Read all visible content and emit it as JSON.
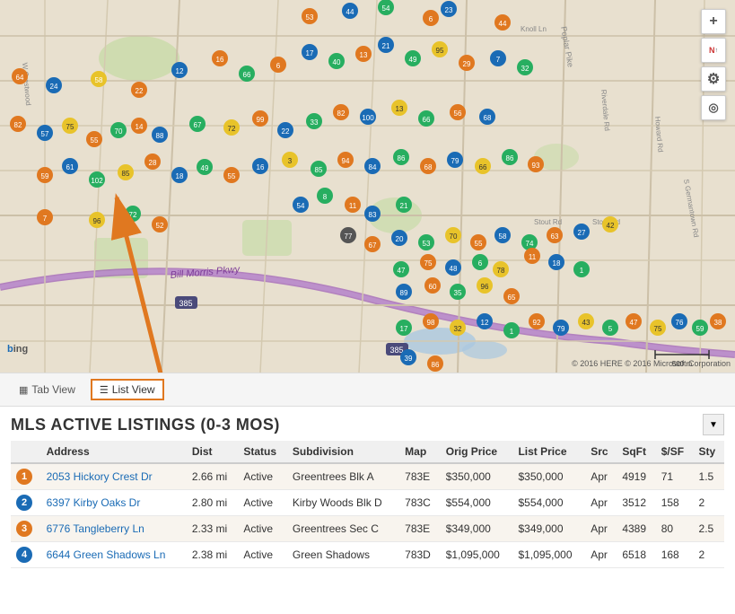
{
  "map": {
    "attribution": "© 2016 HERE  © 2016 Microsoft Corporation",
    "bing_label": "bing"
  },
  "view_toggle": {
    "tab_view_label": "Tab View",
    "list_view_label": "List View",
    "tab_icon": "▦",
    "list_icon": "☰"
  },
  "listings": {
    "title": "MLS ACTIVE LISTINGS (0-3 MOS)",
    "columns": [
      "Address",
      "Dist",
      "Status",
      "Subdivision",
      "Map",
      "Orig Price",
      "List Price",
      "Src",
      "SqFt",
      "$/SF",
      "Sty"
    ],
    "rows": [
      {
        "num": 1,
        "num_color": "#e07820",
        "address": "2053 Hickory Crest Dr",
        "dist": "2.66 mi",
        "status": "Active",
        "subdivision": "Greentrees Blk A",
        "map": "783E",
        "orig_price": "$350,000",
        "list_price": "$350,000",
        "src": "Apr",
        "sqft": "4919",
        "psf": "71",
        "sty": "1.5"
      },
      {
        "num": 2,
        "num_color": "#1a6bb5",
        "address": "6397 Kirby Oaks Dr",
        "dist": "2.80 mi",
        "status": "Active",
        "subdivision": "Kirby Woods Blk D",
        "map": "783C",
        "orig_price": "$554,000",
        "list_price": "$554,000",
        "src": "Apr",
        "sqft": "3512",
        "psf": "158",
        "sty": "2"
      },
      {
        "num": 3,
        "num_color": "#e07820",
        "address": "6776 Tangleberry Ln",
        "dist": "2.33 mi",
        "status": "Active",
        "subdivision": "Greentrees Sec C",
        "map": "783E",
        "orig_price": "$349,000",
        "list_price": "$349,000",
        "src": "Apr",
        "sqft": "4389",
        "psf": "80",
        "sty": "2.5"
      },
      {
        "num": 4,
        "num_color": "#1a6bb5",
        "address": "6644 Green Shadows Ln",
        "dist": "2.38 mi",
        "status": "Active",
        "subdivision": "Green Shadows",
        "map": "783D",
        "orig_price": "$1,095,000",
        "list_price": "$1,095,000",
        "src": "Apr",
        "sqft": "6518",
        "psf": "168",
        "sty": "2"
      }
    ]
  },
  "map_controls": {
    "zoom_in": "+",
    "compass": "N",
    "settings": "⚙",
    "location": "📍"
  }
}
